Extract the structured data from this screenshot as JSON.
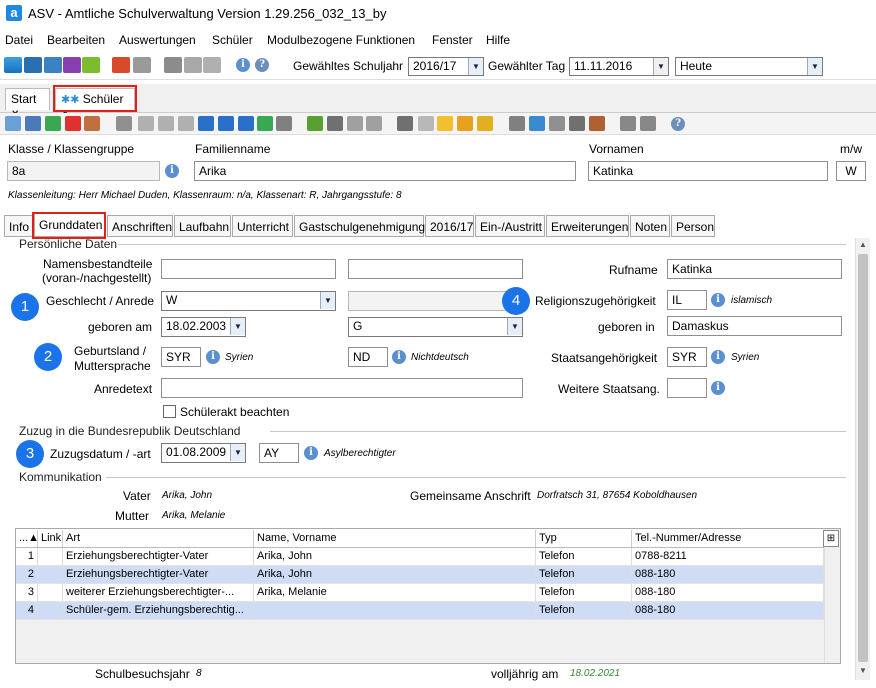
{
  "window": {
    "title": "ASV - Amtliche Schulverwaltung Version 1.29.256_032_13_by",
    "app_icon_letter": "a"
  },
  "menu": [
    "Datei",
    "Bearbeiten",
    "Auswertungen",
    "Schüler",
    "Modulbezogene Funktionen",
    "Fenster",
    "Hilfe"
  ],
  "toolbar": {
    "schuljahr_label": "Gewähltes Schuljahr",
    "schuljahr_value": "2016/17",
    "tag_label": "Gewählter Tag",
    "tag_value": "11.11.2016",
    "heute_value": "Heute"
  },
  "doc_tabs": {
    "start": "Start",
    "schueler": "Schüler",
    "close": "✕"
  },
  "header": {
    "klasse_label": "Klasse / Klassengruppe",
    "klasse_value": "8a",
    "familienname_label": "Familienname",
    "familienname_value": "Arika",
    "vornamen_label": "Vornamen",
    "vornamen_value": "Katinka",
    "mw_label": "m/w",
    "mw_value": "W",
    "klassenleitung": "Klassenleitung: Herr Michael Duden, Klassenraum: n/a, Klassenart: R, Jahrgangsstufe: 8"
  },
  "tabs": [
    "Info",
    "Grunddaten",
    "Anschriften",
    "Laufbahn",
    "Unterricht",
    "Gastschulgenehmigung",
    "2016/17",
    "Ein-/Austritt",
    "Erweiterungen",
    "Noten",
    "Person"
  ],
  "personal": {
    "section": "Persönliche Daten",
    "namensbestandteile_label1": "Namensbestandteile",
    "namensbestandteile_label2": "(voran-/nachgestellt)",
    "rufname_label": "Rufname",
    "rufname_value": "Katinka",
    "geschlecht_label": "Geschlecht / Anrede",
    "geschlecht_value": "W",
    "religion_label": "Religionszugehörigkeit",
    "religion_value": "IL",
    "religion_text": "islamisch",
    "geboren_am_label": "geboren am",
    "geboren_am_value": "18.02.2003",
    "g_value": "G",
    "geboren_in_label": "geboren in",
    "geboren_in_value": "Damaskus",
    "geburtsland_label1": "Geburtsland /",
    "geburtsland_label2": "Muttersprache",
    "geburtsland_value": "SYR",
    "geburtsland_text": "Syrien",
    "muttersprache_value": "ND",
    "muttersprache_text": "Nichtdeutsch",
    "staat_label": "Staatsangehörigkeit",
    "staat_value": "SYR",
    "staat_text": "Syrien",
    "anrede_label": "Anredetext",
    "weitere_label": "Weitere Staatsang.",
    "schuelerakt_label": "Schülerakt beachten"
  },
  "zuzug": {
    "section": "Zuzug in die Bundesrepublik Deutschland",
    "label": "Zuzugsdatum / -art",
    "datum": "01.08.2009",
    "art": "AY",
    "art_text": "Asylberechtigter"
  },
  "kommunikation": {
    "section": "Kommunikation",
    "vater_label": "Vater",
    "vater_value": "Arika, John",
    "mutter_label": "Mutter",
    "mutter_value": "Arika, Melanie",
    "anschrift_label": "Gemeinsame Anschrift",
    "anschrift_value": "Dorfratsch 31, 87654 Koboldhausen"
  },
  "grid": {
    "headers": [
      "...▲",
      "Link",
      "Art",
      "Name, Vorname",
      "Typ",
      "Tel.-Nummer/Adresse"
    ],
    "rows": [
      {
        "nr": "1",
        "art": "Erziehungsberechtigter-Vater",
        "name": "Arika, John",
        "typ": "Telefon",
        "tel": "0788-8211"
      },
      {
        "nr": "2",
        "art": "Erziehungsberechtigter-Vater",
        "name": "Arika, John",
        "typ": "Telefon",
        "tel": "088-180"
      },
      {
        "nr": "3",
        "art": "weiterer Erziehungsberechtigter-...",
        "name": "Arika, Melanie",
        "typ": "Telefon",
        "tel": "088-180"
      },
      {
        "nr": "4",
        "art": "Schüler-gem. Erziehungsberechtig...",
        "name": "",
        "typ": "Telefon",
        "tel": "088-180"
      }
    ]
  },
  "footer": {
    "schulbesuchsjahr_label": "Schulbesuchsjahr",
    "schulbesuchsjahr_value": "8",
    "volljaehrig_label": "volljährig am",
    "volljaehrig_value": "18.02.2021"
  },
  "badges": [
    "1",
    "2",
    "3",
    "4"
  ],
  "colors": {
    "accent": "#1a73e8",
    "highlight": "#e0201a",
    "selected_row": "#cfdcf5",
    "green_date": "#2e8b2e"
  }
}
